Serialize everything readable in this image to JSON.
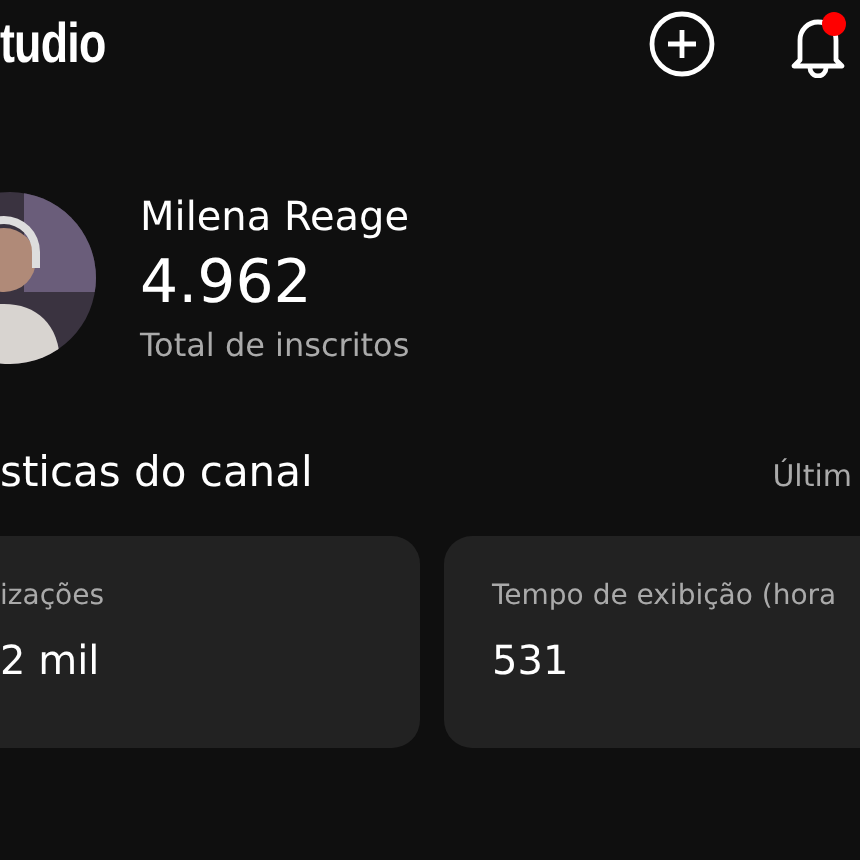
{
  "header": {
    "title": "tudio",
    "notification_badge": true
  },
  "channel": {
    "name": "Milena Reage",
    "subscribers": "4.962",
    "subscribers_label": "Total de inscritos"
  },
  "stats": {
    "title": "sticas do canal",
    "period": "Últim",
    "cards": [
      {
        "label": "izações",
        "value": "2 mil"
      },
      {
        "label": "Tempo de exibição (hora",
        "value": "531"
      }
    ]
  }
}
